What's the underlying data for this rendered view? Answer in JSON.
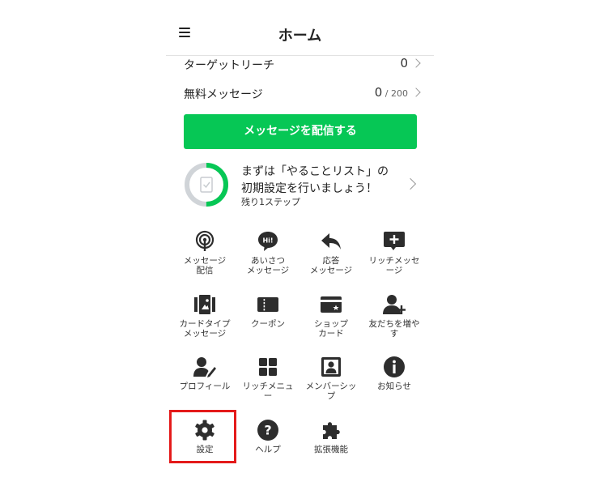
{
  "header": {
    "title": "ホーム"
  },
  "stats": [
    {
      "label": "ターゲットリーチ",
      "value": "0",
      "suffix": ""
    },
    {
      "label": "無料メッセージ",
      "value": "0",
      "suffix": " / 200"
    }
  ],
  "cta": {
    "label": "メッセージを配信する"
  },
  "todo": {
    "line1": "まずは「やることリスト」の",
    "line2": "初期設定を行いましょう！",
    "remaining": "残り1ステップ",
    "progress": 0.5
  },
  "grid": {
    "items": [
      {
        "line1": "メッセージ",
        "line2": "配信",
        "icon": "broadcast-icon"
      },
      {
        "line1": "あいさつ",
        "line2": "メッセージ",
        "icon": "greeting-icon"
      },
      {
        "line1": "応答",
        "line2": "メッセージ",
        "icon": "reply-icon"
      },
      {
        "line1": "リッチメッセ",
        "line2": "ージ",
        "icon": "rich-message-icon"
      },
      {
        "line1": "カードタイプ",
        "line2": "メッセージ",
        "icon": "card-type-icon"
      },
      {
        "line1": "クーポン",
        "line2": "",
        "icon": "coupon-icon"
      },
      {
        "line1": "ショップ",
        "line2": "カード",
        "icon": "shop-card-icon"
      },
      {
        "line1": "友だちを増や",
        "line2": "す",
        "icon": "add-friend-icon"
      },
      {
        "line1": "プロフィール",
        "line2": "",
        "icon": "profile-edit-icon"
      },
      {
        "line1": "リッチメニュ",
        "line2": "ー",
        "icon": "rich-menu-icon"
      },
      {
        "line1": "メンバーシッ",
        "line2": "プ",
        "icon": "membership-icon"
      },
      {
        "line1": "お知らせ",
        "line2": "",
        "icon": "info-icon"
      },
      {
        "line1": "設定",
        "line2": "",
        "icon": "gear-icon"
      },
      {
        "line1": "ヘルプ",
        "line2": "",
        "icon": "help-icon"
      },
      {
        "line1": "拡張機能",
        "line2": "",
        "icon": "puzzle-icon"
      }
    ]
  },
  "colors": {
    "accent": "#06c755",
    "highlight": "#e41a1a",
    "icon": "#2d2d2d",
    "track": "#d0d4d8"
  }
}
